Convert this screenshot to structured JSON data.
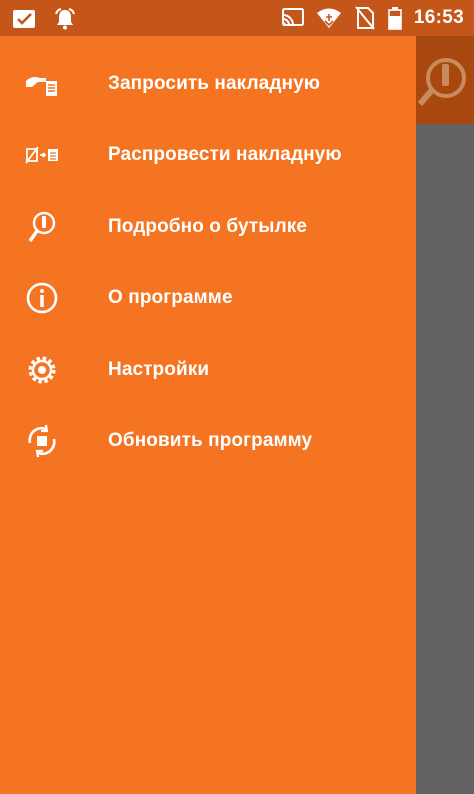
{
  "status_bar": {
    "time": "16:53",
    "left_icons": [
      "checkbox-notification-icon",
      "alarm-bell-icon"
    ],
    "right_icons": [
      "cast-icon",
      "wifi-icon",
      "no-sim-icon",
      "battery-icon"
    ]
  },
  "drawer": {
    "items": [
      {
        "label": "Запросить накладную",
        "icon": "request-invoice-icon"
      },
      {
        "label": "Распровести накладную",
        "icon": "unpost-invoice-icon"
      },
      {
        "label": "Подробно о бутылке",
        "icon": "bottle-search-icon"
      },
      {
        "label": "О программе",
        "icon": "info-icon"
      },
      {
        "label": "Настройки",
        "icon": "gear-icon"
      },
      {
        "label": "Обновить программу",
        "icon": "update-icon"
      }
    ]
  },
  "colors": {
    "drawer_bg": "#f47422",
    "status_bar_bg": "#c5561a",
    "app_bar_bg": "#a8480f",
    "scrim": "#636363",
    "text": "#ffffff"
  }
}
